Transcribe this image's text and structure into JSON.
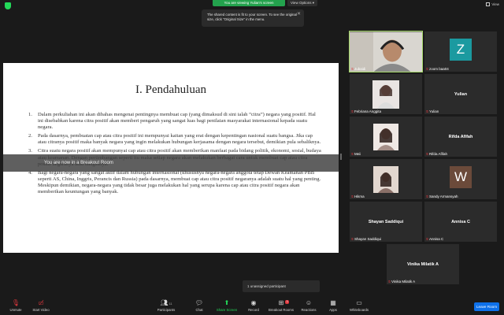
{
  "top_bar": {
    "viewing_text": "You are viewing Yulian's screen",
    "view_options": "View Options ▾",
    "view_label": "View"
  },
  "notice": {
    "text": "The shared content is fit to your screen. To see the original size, click \"Original Size\" in the menu."
  },
  "slide": {
    "title": "I.  Pendahuluan",
    "items": [
      {
        "num": "1.",
        "text": "Dalam perkuliahan ini akan dibahas mengenai pentingnya membuat cap (yang dimaksud di sini ialah “citra”) negara yang positif. Hal ini disebabkan karena citra positif akan memberi pengaruh yang sangat luas bagi penilaian masyarakat internasional kepada suatu negara."
      },
      {
        "num": "2.",
        "text": "Pada dasarnya, pembuatan cap atau citra positif ini mempunyai kaitan yang erat dengan kepentingan nasional suatu bangsa. Jika cap atau citranya positif maka banyak negara yang ingin melakukan hubungan kerjasama dengan negara tersebut, demikian pula sebaliknya."
      },
      {
        "num": "3.",
        "text": "Citra suatu negara positif akan mempunyai cap atau citra positif akan memberikan manfaat pada bidang politik, ekonomi, sosial, budaya atau keamanan. Dengan pertimbangan seperti itu maka setiap negara akan melakukan berbagai cara untuk membuat cap atau citra positif negaranya atau bangsanya."
      },
      {
        "num": "4.",
        "text": "Bagi negara-negara yang sangat aktif dalam hubungan internasional (khususnya negara-negara anggota tetap Dewan Keamanan PBB seperti AS, China, Inggris, Perancis dan Russia) pada dasarnya, membuat cap atau citra positif negaranya adalah suatu hal yang penting. Meskipun demikian, negara-negara yang tidak besar juga melakukan hal yang serupa karena cap atau citra positif negara akan memberikan keuntungan yang banyak."
      }
    ]
  },
  "breakout_banner": "You are now in a Breakout Room",
  "participants": [
    {
      "name": "Jubaidi",
      "kind": "video"
    },
    {
      "name": "zoom baa04",
      "kind": "letter",
      "letter": "Z",
      "color": "#1b9aa0"
    },
    {
      "name": "Febriana Anggita",
      "kind": "video"
    },
    {
      "name": "Yulian",
      "kind": "name",
      "center": "Yulian"
    },
    {
      "name": "Meii",
      "kind": "video"
    },
    {
      "name": "Rifda Afifah",
      "kind": "name",
      "center": "Rifda Afifah"
    },
    {
      "name": "Hikma",
      "kind": "video"
    },
    {
      "name": "Sandy Armansyah",
      "kind": "letter",
      "letter": "W",
      "color": "#6b4a3a"
    },
    {
      "name": "Shayan Saddiqui",
      "kind": "name",
      "center": "Shayan Saddiqui"
    },
    {
      "name": "Annisa C",
      "kind": "name",
      "center": "Annisa C"
    },
    {
      "name": "Vinika Milatik A",
      "kind": "name",
      "center": "Vinika Milatik A"
    }
  ],
  "unassigned": "1 unassigned participant",
  "toolbar": {
    "unmute": "Unmute",
    "start_video": "Start Video",
    "participants": "Participants",
    "participants_count": "11",
    "chat": "Chat",
    "share_screen": "Share Screen",
    "record": "Record",
    "breakout_rooms": "Breakout Rooms",
    "breakout_badge": "1",
    "reactions": "Reactions",
    "apps": "Apps",
    "whiteboards": "Whiteboards",
    "leave": "Leave Room"
  }
}
